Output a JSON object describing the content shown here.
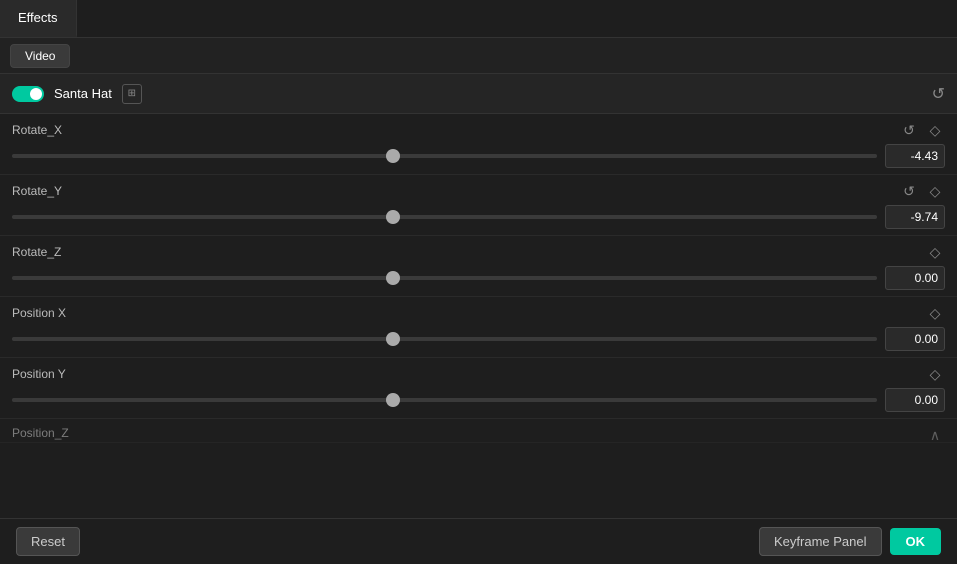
{
  "tabs": {
    "primary": [
      {
        "id": "effects",
        "label": "Effects",
        "active": true
      }
    ],
    "secondary": [
      {
        "id": "video",
        "label": "Video",
        "active": true
      }
    ]
  },
  "effect": {
    "name": "Santa Hat",
    "enabled": true,
    "icon": "grid-icon"
  },
  "sliders": [
    {
      "id": "rotate_x",
      "label": "Rotate_X",
      "value": "-4.43",
      "thumb_pct": 44,
      "has_reset": true,
      "has_diamond": true
    },
    {
      "id": "rotate_y",
      "label": "Rotate_Y",
      "value": "-9.74",
      "thumb_pct": 44,
      "has_reset": true,
      "has_diamond": true
    },
    {
      "id": "rotate_z",
      "label": "Rotate_Z",
      "value": "0.00",
      "thumb_pct": 44,
      "has_reset": false,
      "has_diamond": true
    },
    {
      "id": "position_x",
      "label": "Position X",
      "value": "0.00",
      "thumb_pct": 44,
      "has_reset": false,
      "has_diamond": true
    },
    {
      "id": "position_y",
      "label": "Position Y",
      "value": "0.00",
      "thumb_pct": 44,
      "has_reset": false,
      "has_diamond": true
    }
  ],
  "partial_row": {
    "label": "Position_Z",
    "has_chevron": true
  },
  "buttons": {
    "reset": "Reset",
    "keyframe": "Keyframe Panel",
    "ok": "OK"
  },
  "icons": {
    "reset_unicode": "↺",
    "diamond_unicode": "◇",
    "chevron_up": "∧"
  }
}
